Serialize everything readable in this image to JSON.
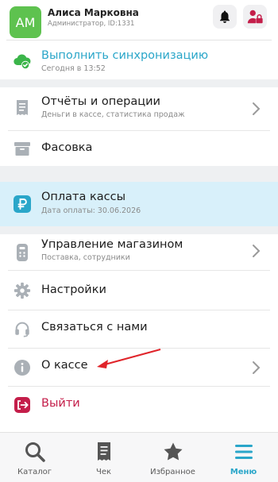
{
  "user": {
    "initials": "AM",
    "name": "Алиса Марковна",
    "role": "Администратор, ID:1331"
  },
  "header": {
    "bell_icon": "bell-icon",
    "user_lock_icon": "user-lock-icon"
  },
  "menu": {
    "sync": {
      "title": "Выполнить синхронизацию",
      "sub": "Сегодня в 13:52",
      "icon": "cloud-sync-icon"
    },
    "reports": {
      "title": "Отчёты и операции",
      "sub": "Деньги в кассе, статистика продаж",
      "icon": "receipt-icon"
    },
    "packing": {
      "title": "Фасовка",
      "icon": "box-icon"
    },
    "payment": {
      "title": "Оплата кассы",
      "sub": "Дата оплаты: 30.06.2026",
      "icon": "ruble-icon"
    },
    "store": {
      "title": "Управление магазином",
      "sub": "Поставка, сотрудники",
      "icon": "store-device-icon"
    },
    "settings": {
      "title": "Настройки",
      "icon": "gear-icon"
    },
    "contact": {
      "title": "Связаться с нами",
      "icon": "headset-icon"
    },
    "about": {
      "title": "О кассе",
      "icon": "info-icon"
    },
    "logout": {
      "title": "Выйти",
      "icon": "logout-icon"
    }
  },
  "tabs": [
    {
      "label": "Каталог",
      "icon": "search-icon"
    },
    {
      "label": "Чек",
      "icon": "receipt-icon"
    },
    {
      "label": "Избранное",
      "icon": "star-icon"
    },
    {
      "label": "Меню",
      "icon": "menu-icon",
      "active": true
    }
  ],
  "colors": {
    "accent": "#2aa6c9",
    "green": "#3bb54a",
    "payment_bg": "#d8f0fa",
    "logout": "#c41e4a",
    "avatar": "#5ec24f",
    "annotation": "#e0242a"
  }
}
